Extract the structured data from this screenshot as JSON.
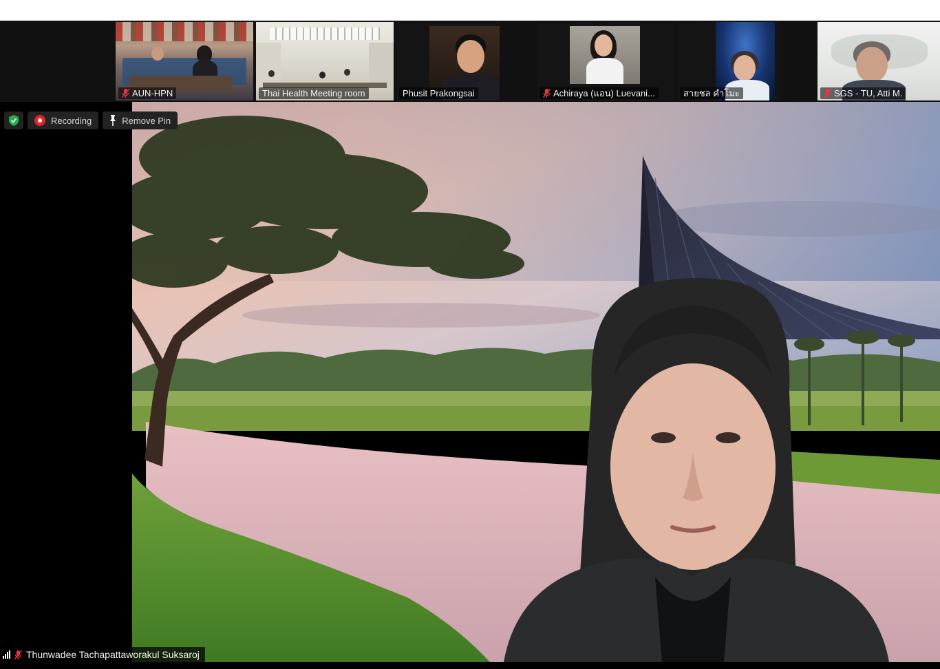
{
  "toolbar": {
    "recording_label": "Recording",
    "remove_pin_label": "Remove Pin"
  },
  "participants": [
    {
      "name": "AUN-HPN",
      "muted": true
    },
    {
      "name": "Thai Health Meeting room",
      "muted": false
    },
    {
      "name": "Phusit Prakongsai",
      "muted": false
    },
    {
      "name": "Achiraya (แอน) Luevani...",
      "muted": true
    },
    {
      "name": "สายชล คำโมะ",
      "muted": false
    },
    {
      "name": "SGS - TU, Atti M.",
      "muted": true
    }
  ],
  "active_speaker": {
    "name": "Thunwadee Tachapattaworakul Suksaroj",
    "muted": true
  },
  "colors": {
    "muted_mic": "#e5393b",
    "shield_green": "#22b04b",
    "recording_red": "#e0262a"
  }
}
